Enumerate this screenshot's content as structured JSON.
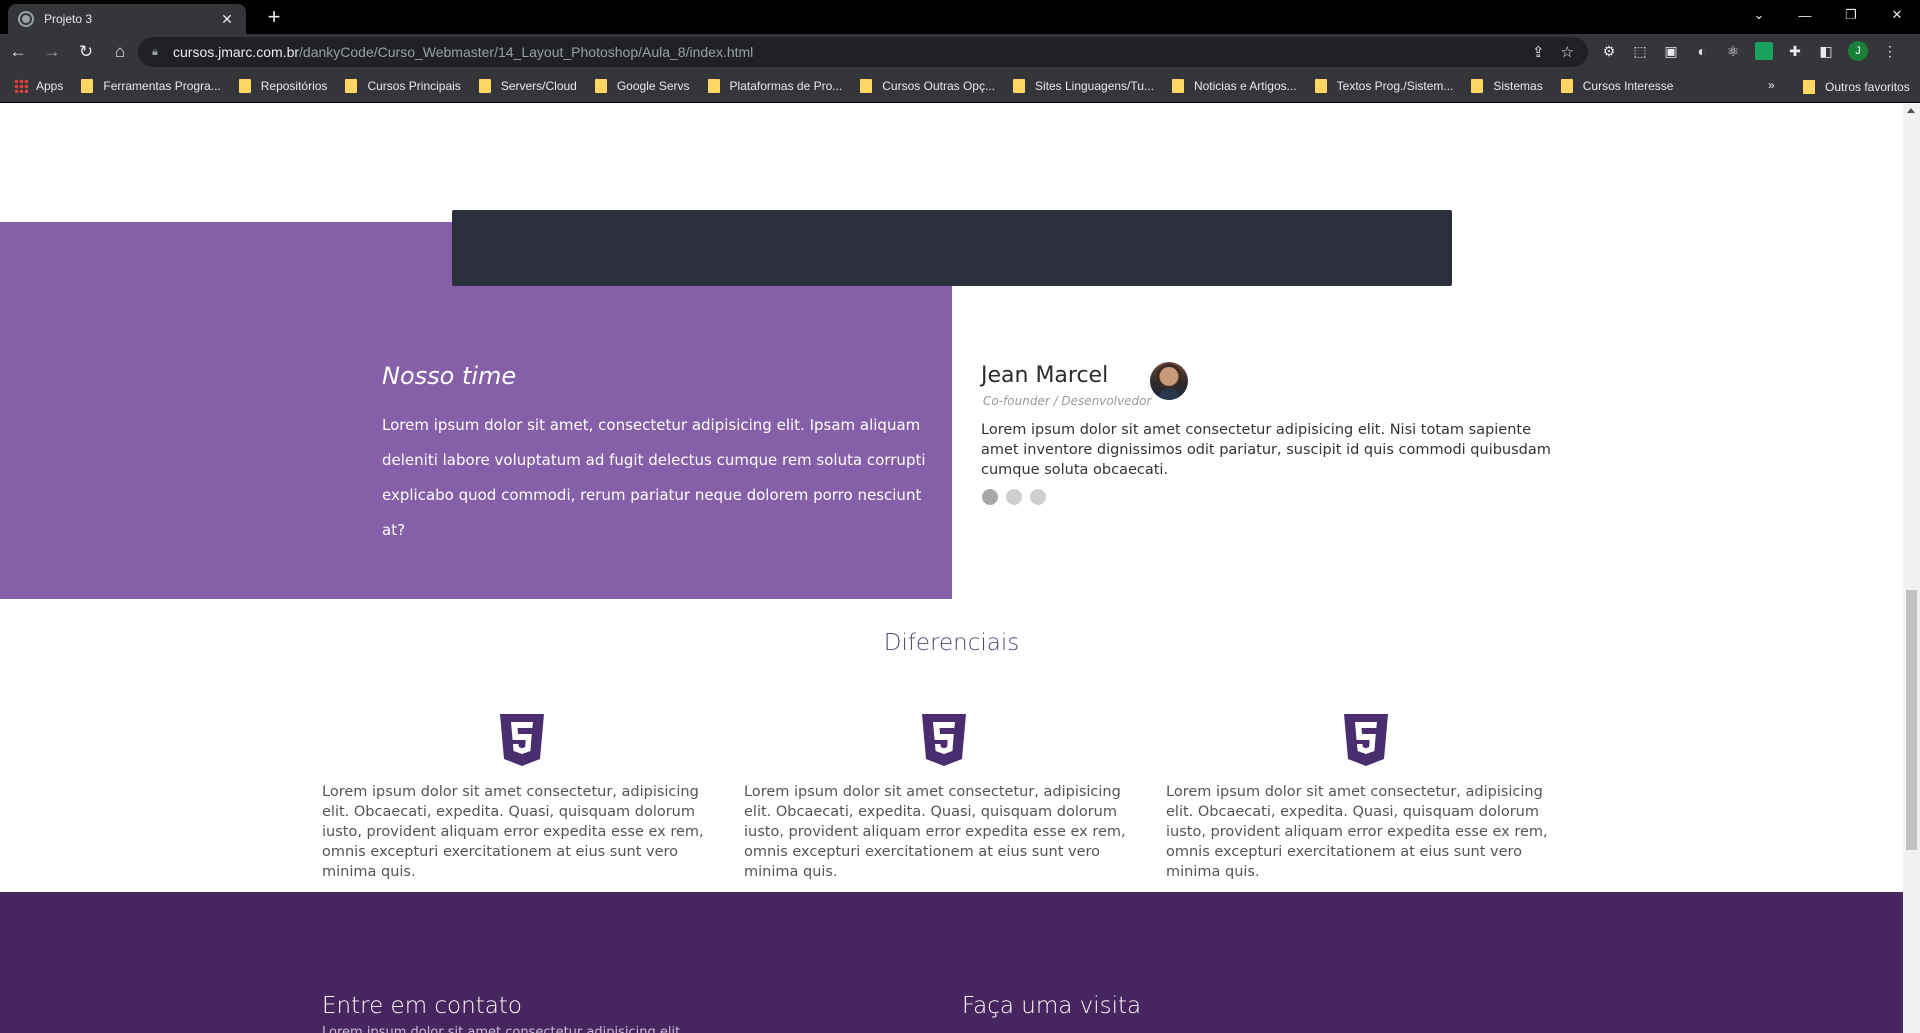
{
  "browser": {
    "tab_title": "Projeto 3",
    "tab_close": "✕",
    "new_tab": "+",
    "url_host": "cursos.jmarc.com.br",
    "url_path": "/dankyCode/Curso_Webmaster/14_Layout_Photoshop/Aula_8/index.html",
    "window_controls": [
      "⌄",
      "—",
      "❐",
      "✕"
    ],
    "bookmarks": [
      "Apps",
      "Ferramentas Progra...",
      "Repositórios",
      "Cursos Principais",
      "Servers/Cloud",
      "Google Servs",
      "Plataformas de Pro...",
      "Cursos Outras Opç...",
      "Sites Linguagens/Tu...",
      "Noticias e Artigos...",
      "Textos Prog./Sistem...",
      "Sistemas",
      "Cursos Interesse"
    ],
    "bookmarks_more": "»",
    "other_bookmarks": "Outros favoritos",
    "profile_initial": "J"
  },
  "team": {
    "title": "Nosso time",
    "text": "Lorem ipsum dolor sit amet, consectetur adipisicing elit. Ipsam aliquam deleniti labore voluptatum ad fugit delectus cumque rem soluta corrupti explicabo quod commodi, rerum pariatur neque dolorem porro nesciunt at?",
    "member": {
      "name": "Jean Marcel",
      "role": "Co-founder / Desenvolvedor",
      "text": "Lorem ipsum dolor sit amet consectetur adipisicing elit. Nisi totam sapiente amet inventore dignissimos odit pariatur, suscipit id quis commodi quibusdam cumque soluta obcaecati."
    },
    "slider_dots": 3,
    "active_dot": 1
  },
  "diferenciais": {
    "title": "Diferenciais",
    "items": [
      {
        "icon": "html5-icon",
        "text": "Lorem ipsum dolor sit amet consectetur, adipisicing elit. Obcaecati, expedita. Quasi, quisquam dolorum iusto, provident aliquam error expedita esse ex rem, omnis excepturi exercitationem at eius sunt vero minima quis."
      },
      {
        "icon": "html5-icon",
        "text": "Lorem ipsum dolor sit amet consectetur, adipisicing elit. Obcaecati, expedita. Quasi, quisquam dolorum iusto, provident aliquam error expedita esse ex rem, omnis excepturi exercitationem at eius sunt vero minima quis."
      },
      {
        "icon": "html5-icon",
        "text": "Lorem ipsum dolor sit amet consectetur, adipisicing elit. Obcaecati, expedita. Quasi, quisquam dolorum iusto, provident aliquam error expedita esse ex rem, omnis excepturi exercitationem at eius sunt vero minima quis."
      }
    ]
  },
  "footer": {
    "contact_title": "Entre em contato",
    "contact_sub": "Lorem ipsum dolor sit amet consectetur adipisicing elit.",
    "visit_title": "Faça uma visita"
  },
  "colors": {
    "purple": "#855fa8",
    "dark_bar": "#2c2f3c",
    "footer": "#47265f",
    "html5_icon": "#4a2d6e"
  }
}
